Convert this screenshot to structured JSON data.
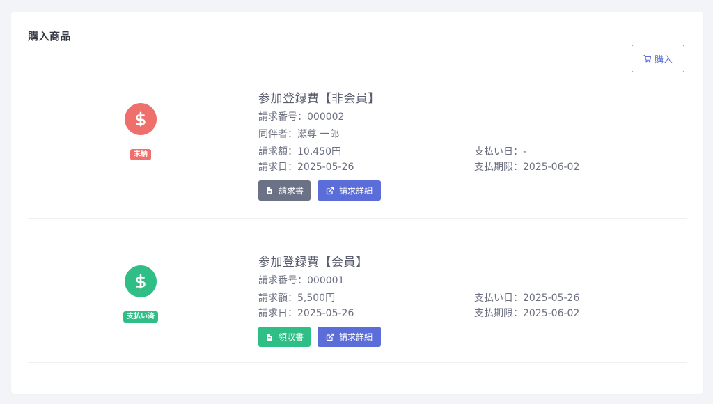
{
  "section": {
    "title": "購入商品",
    "buy_button_label": "購入"
  },
  "items": [
    {
      "title": "参加登録費【非会員】",
      "status_label": "未納",
      "status_color": "#ef6f6c",
      "invoice_number": "請求番号：000002",
      "companion": "同伴者：瀬尊 一郎",
      "amount": "請求額：10,450円",
      "invoice_date": "請求日：2025-05-26",
      "payment_date": "支払い日：-",
      "payment_deadline": "支払期限：2025-06-02",
      "doc_button_label": "請求書",
      "detail_button_label": "請求詳細"
    },
    {
      "title": "参加登録費【会員】",
      "status_label": "支払い済",
      "status_color": "#2fbf86",
      "invoice_number": "請求番号：000001",
      "amount": "請求額：5,500円",
      "invoice_date": "請求日：2025-05-26",
      "payment_date": "支払い日：2025-05-26",
      "payment_deadline": "支払期限：2025-06-02",
      "doc_button_label": "領収書",
      "detail_button_label": "請求詳細"
    }
  ],
  "icons": {
    "status": "dollar-icon",
    "buy": "cart-icon",
    "document": "file-icon",
    "detail": "external-link-icon"
  },
  "colors": {
    "accent": "#5b6dd8",
    "unpaid": "#ef6f6c",
    "paid": "#2fbf86",
    "secondary_button": "#6c7285"
  }
}
